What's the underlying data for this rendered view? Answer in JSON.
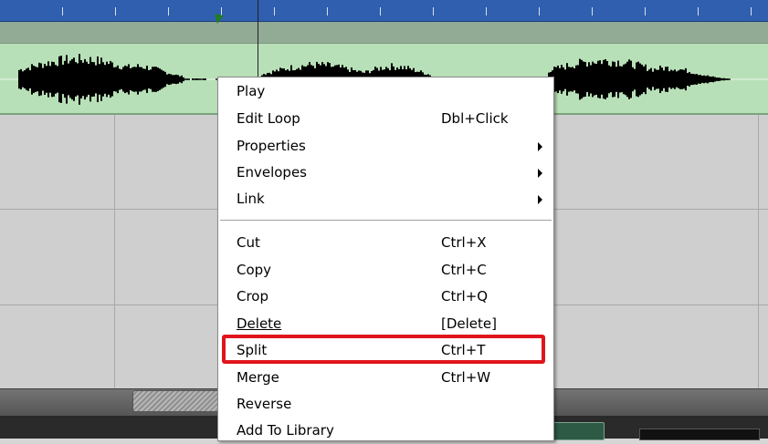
{
  "timeline": {
    "ruler_tick_count": 15,
    "colors": {
      "ruler": "#2f5fae",
      "clip_header": "#91ab94",
      "clip_body": "#b8e0b8",
      "waveform": "#000000",
      "grid_background": "#cfcfcf"
    }
  },
  "context_menu": {
    "items": [
      {
        "label": "Play",
        "shortcut": ""
      },
      {
        "label": "Edit Loop",
        "shortcut": "Dbl+Click"
      },
      {
        "label": "Properties",
        "shortcut": "",
        "submenu": true
      },
      {
        "label": "Envelopes",
        "shortcut": "",
        "submenu": true
      },
      {
        "label": "Link",
        "shortcut": "",
        "submenu": true
      },
      {
        "label": "Cut",
        "shortcut": "Ctrl+X"
      },
      {
        "label": "Copy",
        "shortcut": "Ctrl+C"
      },
      {
        "label": "Crop",
        "shortcut": "Ctrl+Q"
      },
      {
        "label": "Delete",
        "shortcut": "[Delete]"
      },
      {
        "label": "Split",
        "shortcut": "Ctrl+T",
        "highlighted": true
      },
      {
        "label": "Merge",
        "shortcut": "Ctrl+W"
      },
      {
        "label": "Reverse",
        "shortcut": ""
      },
      {
        "label": "Add To Library",
        "shortcut": ""
      }
    ],
    "highlight_color": "#e0151c"
  }
}
